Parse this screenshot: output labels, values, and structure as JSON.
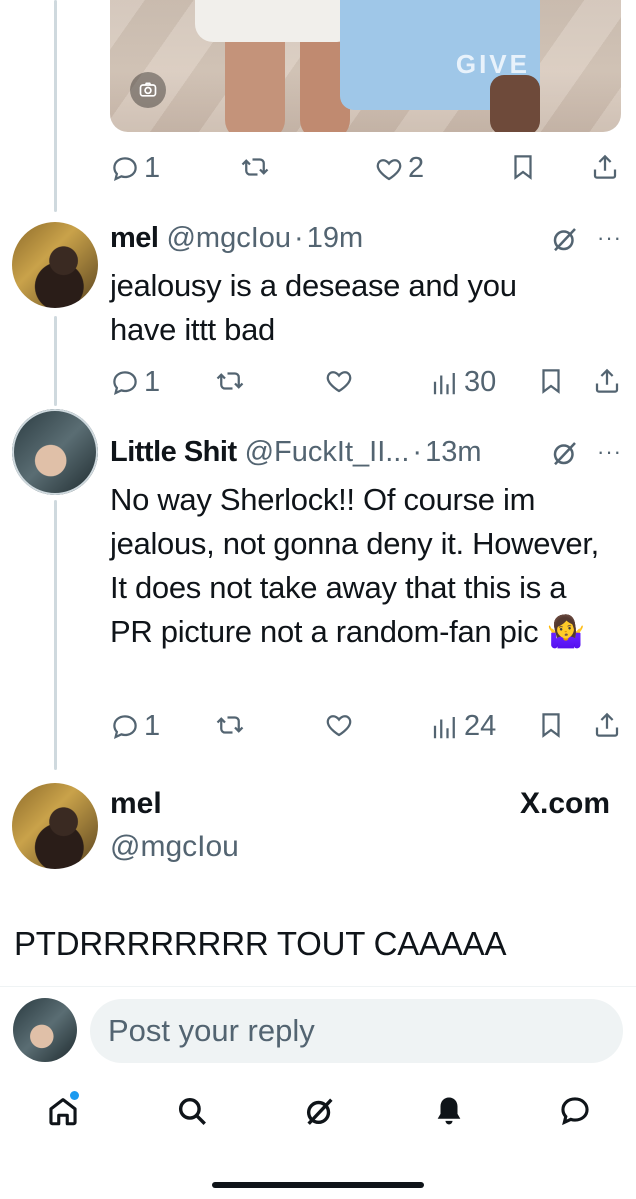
{
  "colors": {
    "text": "#0f1419",
    "muted": "#536471",
    "accent": "#1d9bf0",
    "line": "#cfd9de",
    "input_bg": "#eff3f4"
  },
  "top_post": {
    "photo_brand_text": "GIVE",
    "actions": {
      "replies": "1",
      "reposts": "",
      "likes": "2"
    }
  },
  "tweets": [
    {
      "name": "mel",
      "handle": "@mgcIou",
      "separator": "·",
      "time": "19m",
      "body": "jealousy is a desease and you have ittt bad",
      "actions": {
        "replies": "1",
        "views": "30"
      }
    },
    {
      "name": "Little Shit",
      "handle": "@FuckIt_II...",
      "separator": "·",
      "time": "13m",
      "body": "No way Sherlock!! Of course im jealous, not gonna deny it. However, It does not take away that this is a PR picture not a random-fan pic 🤷‍♀️",
      "actions": {
        "replies": "1",
        "views": "24"
      }
    }
  ],
  "quoted_card": {
    "name": "mel",
    "handle": "@mgcIou",
    "source": "X.com",
    "text": "PTDRRRRRRRR TOUT CAAAAA"
  },
  "reply_box": {
    "placeholder": "Post your reply"
  },
  "tabbar": [
    "home-icon",
    "search-icon",
    "grok-icon",
    "notifications-icon",
    "messages-icon"
  ]
}
